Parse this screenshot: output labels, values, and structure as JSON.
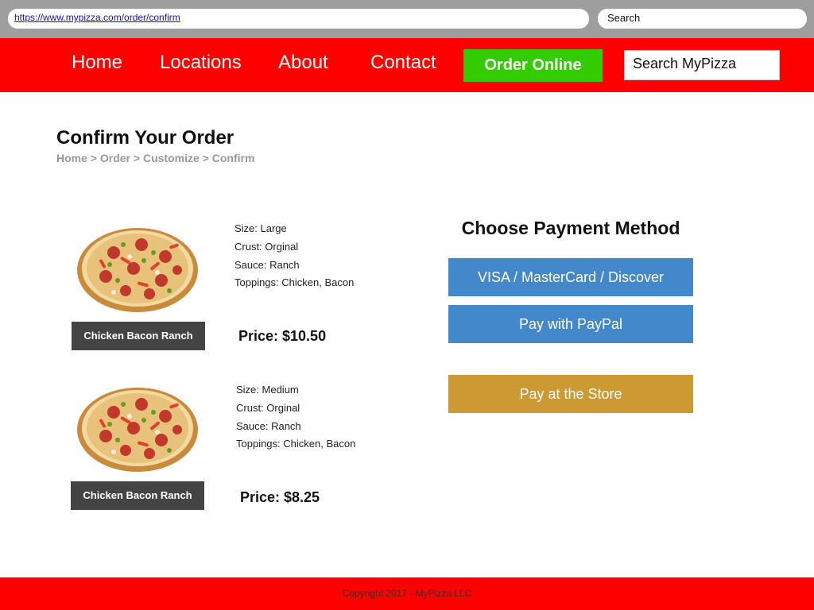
{
  "browser": {
    "url": "https://www.mypizza.com/order/confirm",
    "search_label": "Search"
  },
  "nav": {
    "items": [
      "Home",
      "Locations",
      "About",
      "Contact"
    ],
    "order_online": "Order Online",
    "search_placeholder": "Search MyPizza"
  },
  "page": {
    "title": "Confirm Your Order",
    "breadcrumb": [
      "Home",
      "Order",
      "Customize",
      "Confirm"
    ],
    "breadcrumb_separator": ">"
  },
  "order_items": [
    {
      "name": "Chicken Bacon Ranch",
      "size": "Size: Large",
      "crust": "Crust: Orginal",
      "sauce": "Sauce: Ranch",
      "toppings": "Toppings: Chicken, Bacon",
      "price": "Price: $10.50"
    },
    {
      "name": "Chicken Bacon Ranch",
      "size": "Size: Medium",
      "crust": "Crust: Orginal",
      "sauce": "Sauce: Ranch",
      "toppings": "Toppings: Chicken, Bacon",
      "price": "Price: $8.25"
    }
  ],
  "payment": {
    "title": "Choose Payment Method",
    "card": "VISA / MasterCard / Discover",
    "paypal": "Pay with PayPal",
    "store": "Pay at the Store"
  },
  "footer": {
    "copyright": "Copyright 2017 - MyPizza LLC"
  },
  "colors": {
    "brand_red": "#ff0000",
    "order_green": "#33cc00",
    "pay_blue": "#4488cc",
    "pay_gold": "#cc9933"
  }
}
